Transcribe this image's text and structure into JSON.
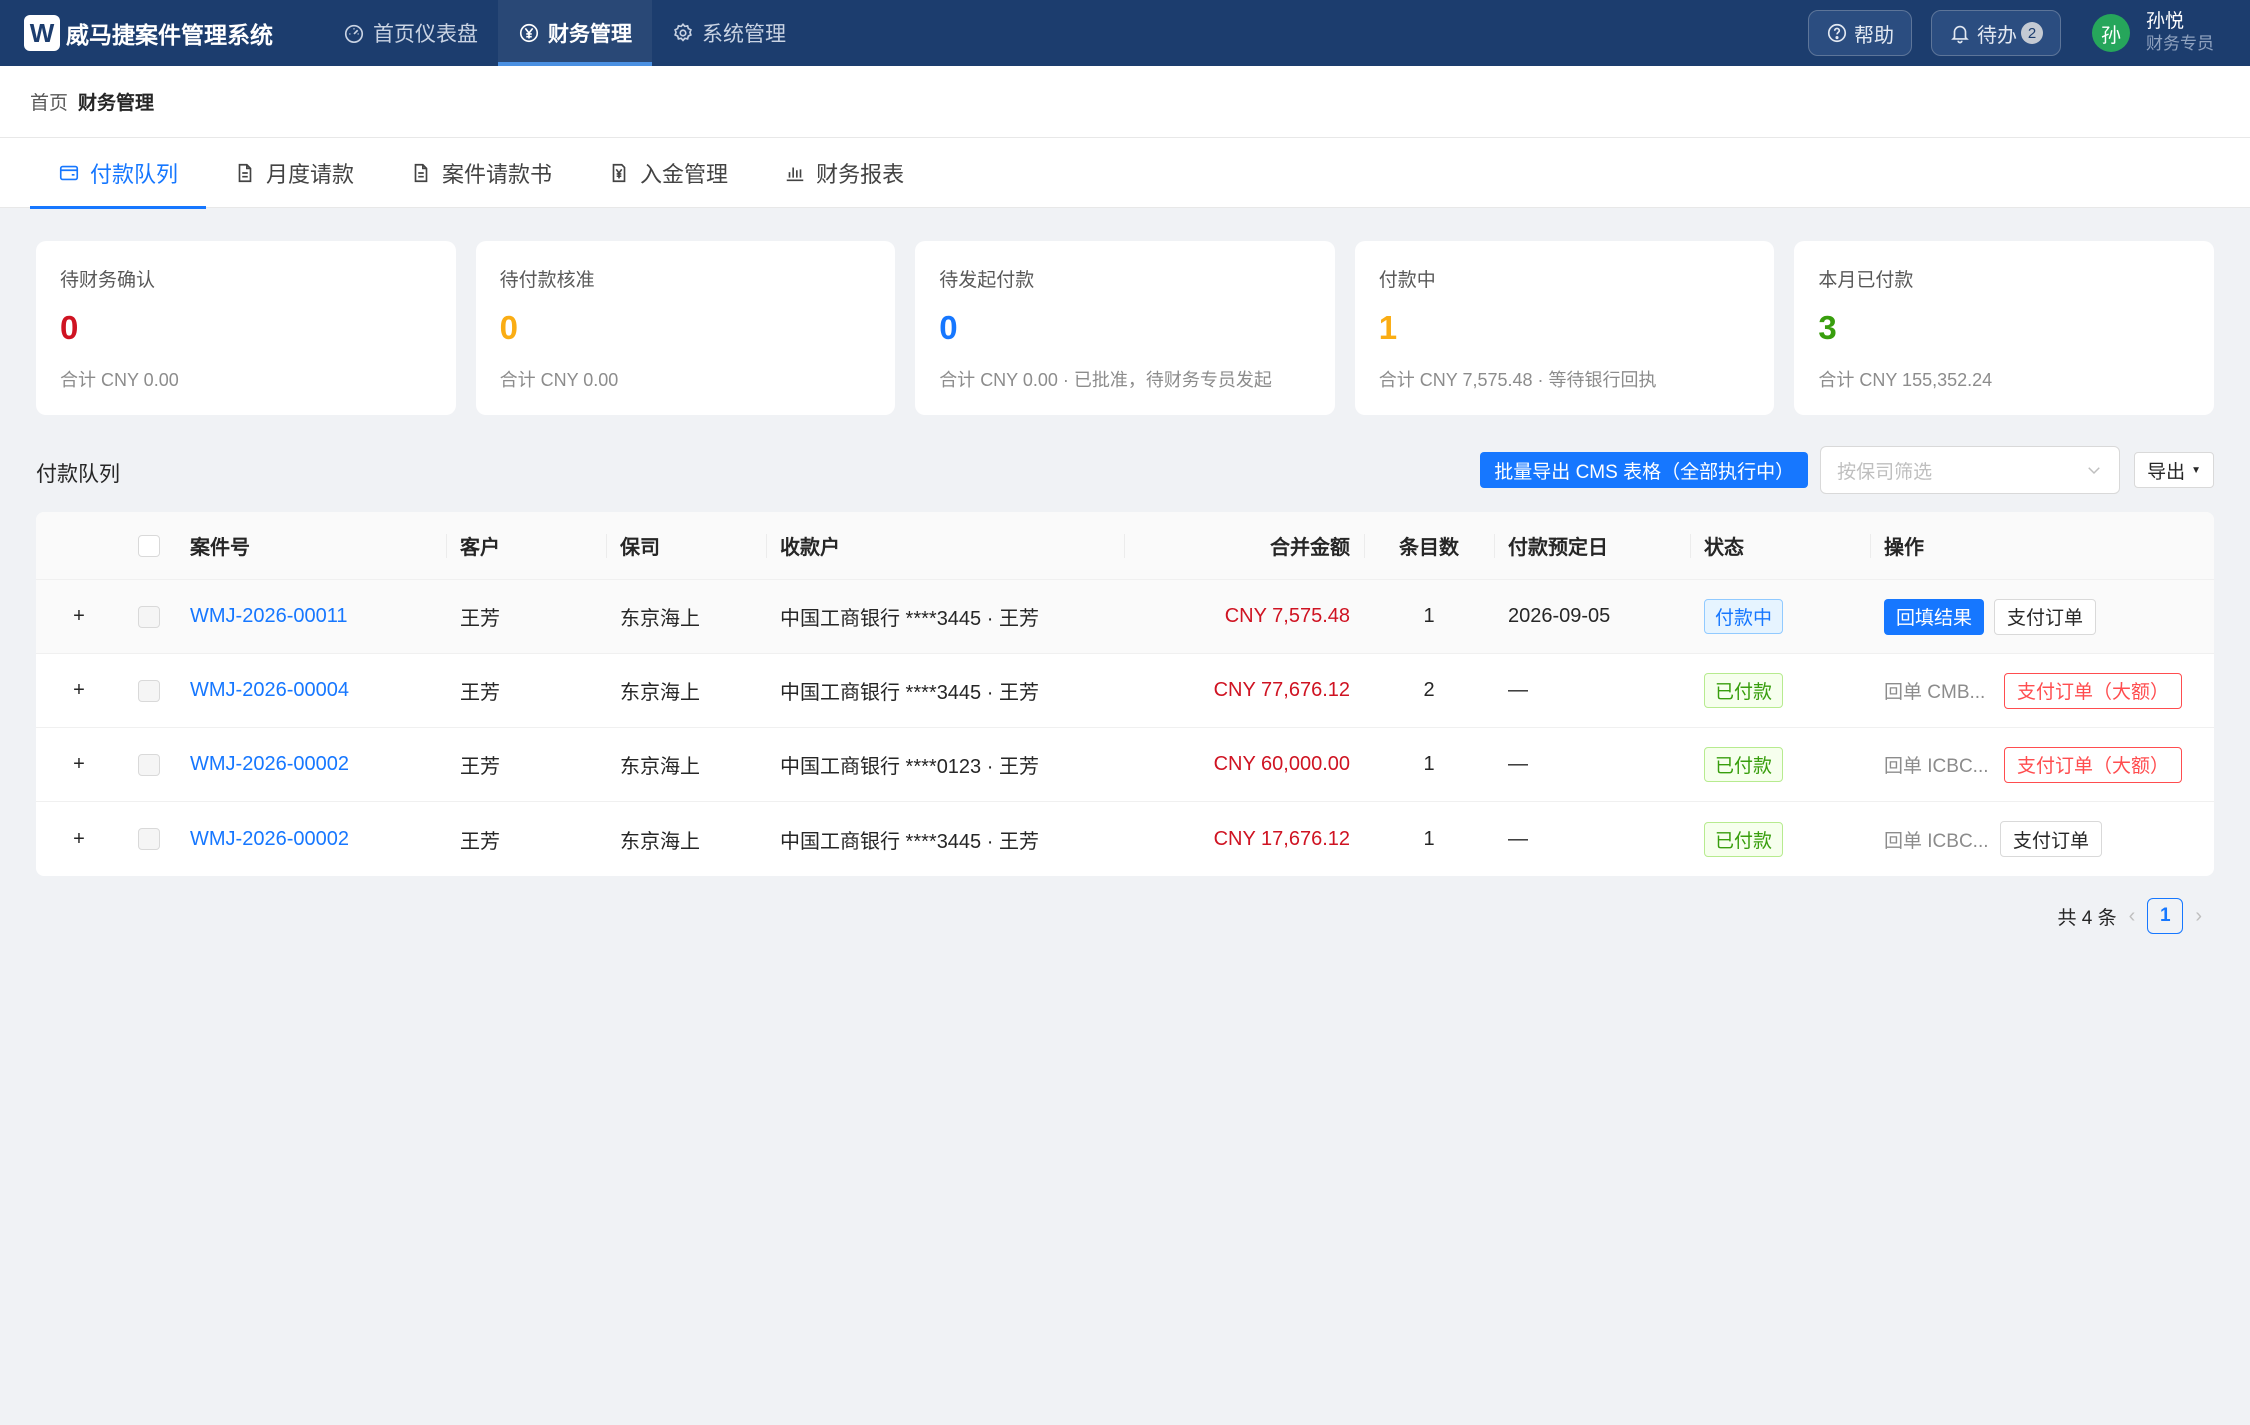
{
  "app": {
    "logo_letter": "W",
    "title": "威马捷案件管理系统"
  },
  "nav": [
    {
      "label": "首页仪表盘",
      "icon": "dashboard-icon"
    },
    {
      "label": "财务管理",
      "icon": "finance-icon",
      "active": true
    },
    {
      "label": "系统管理",
      "icon": "gear-icon"
    }
  ],
  "header_right": {
    "help_label": "帮助",
    "todo_label": "待办",
    "todo_count": "2",
    "user": {
      "avatar_text": "孙",
      "name": "孙悦",
      "role": "财务专员"
    }
  },
  "breadcrumb": {
    "home": "首页",
    "current": "财务管理"
  },
  "tabs": [
    {
      "label": "付款队列",
      "icon": "wallet-icon",
      "active": true
    },
    {
      "label": "月度请款",
      "icon": "document-icon"
    },
    {
      "label": "案件请款书",
      "icon": "document-icon"
    },
    {
      "label": "入金管理",
      "icon": "yen-icon"
    },
    {
      "label": "财务报表",
      "icon": "bar-chart-icon"
    }
  ],
  "stats": [
    {
      "title": "待财务确认",
      "value": "0",
      "subtitle": "合计 CNY 0.00",
      "color": "#cf1322"
    },
    {
      "title": "待付款核准",
      "value": "0",
      "subtitle": "合计 CNY 0.00",
      "color": "#faad14"
    },
    {
      "title": "待发起付款",
      "value": "0",
      "subtitle": "合计 CNY 0.00 · 已批准，待财务专员发起",
      "color": "#1677ff"
    },
    {
      "title": "付款中",
      "value": "1",
      "subtitle": "合计 CNY 7,575.48 · 等待银行回执",
      "color": "#faad14"
    },
    {
      "title": "本月已付款",
      "value": "3",
      "subtitle": "合计 CNY 155,352.24",
      "color": "#389e0d"
    }
  ],
  "section": {
    "title": "付款队列",
    "batch_export_label": "批量导出 CMS 表格（全部执行中）",
    "filter_placeholder": "按保司筛选",
    "export_label": "导出"
  },
  "table": {
    "columns": {
      "case_no": "案件号",
      "client": "客户",
      "insurer": "保司",
      "payee": "收款户",
      "amount": "合并金额",
      "count": "条目数",
      "due_date": "付款预定日",
      "status": "状态",
      "ops": "操作"
    },
    "rows": [
      {
        "case_no": "WMJ-2026-00011",
        "client": "王芳",
        "insurer": "东京海上",
        "payee": "中国工商银行 ****3445 · 王芳",
        "amount": "CNY 7,575.48",
        "count": "1",
        "due_date": "2026-09-05",
        "status": "付款中",
        "receipt": "",
        "op1": "回填结果",
        "op2": "支付订单"
      },
      {
        "case_no": "WMJ-2026-00004",
        "client": "王芳",
        "insurer": "东京海上",
        "payee": "中国工商银行 ****3445 · 王芳",
        "amount": "CNY 77,676.12",
        "count": "2",
        "due_date": "—",
        "status": "已付款",
        "receipt": "回单 CMB...",
        "op2": "支付订单（大额）"
      },
      {
        "case_no": "WMJ-2026-00002",
        "client": "王芳",
        "insurer": "东京海上",
        "payee": "中国工商银行 ****0123 · 王芳",
        "amount": "CNY 60,000.00",
        "count": "1",
        "due_date": "—",
        "status": "已付款",
        "receipt": "回单 ICBC...",
        "op2": "支付订单（大额）"
      },
      {
        "case_no": "WMJ-2026-00002",
        "client": "王芳",
        "insurer": "东京海上",
        "payee": "中国工商银行 ****3445 · 王芳",
        "amount": "CNY 17,676.12",
        "count": "1",
        "due_date": "—",
        "status": "已付款",
        "receipt": "回单 ICBC...",
        "op2": "支付订单"
      }
    ]
  },
  "pagination": {
    "total_label": "共 4 条",
    "current_page": "1"
  }
}
